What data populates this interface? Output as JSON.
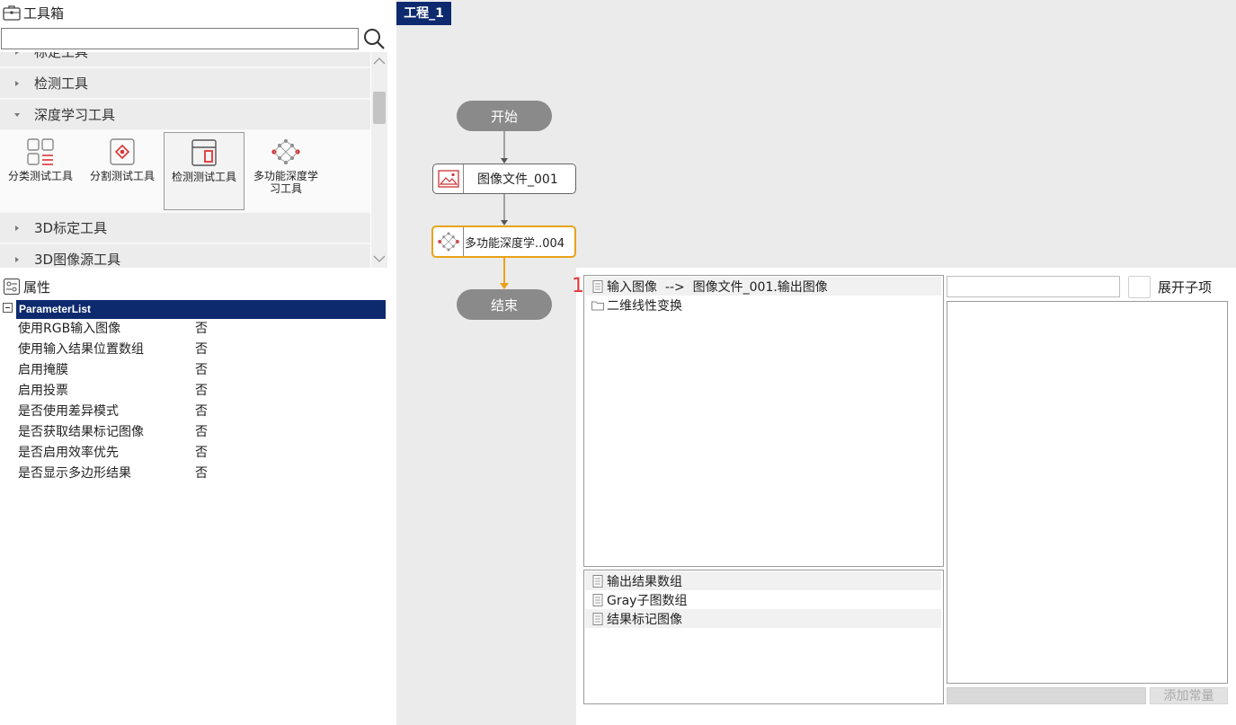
{
  "toolbox": {
    "title": "工具箱",
    "search_value": "",
    "categories": [
      {
        "label": "标定工具",
        "expanded": false
      },
      {
        "label": "检测工具",
        "expanded": false
      },
      {
        "label": "深度学习工具",
        "expanded": true
      },
      {
        "label": "3D标定工具",
        "expanded": false
      },
      {
        "label": "3D图像源工具",
        "expanded": false
      }
    ],
    "tools": [
      {
        "label": "分类测试工具",
        "icon": "classify-icon"
      },
      {
        "label": "分割测试工具",
        "icon": "segment-icon"
      },
      {
        "label": "检测测试工具",
        "icon": "detect-icon",
        "selected": true
      },
      {
        "label": "多功能深度学习工具",
        "icon": "multi-dl-icon"
      }
    ]
  },
  "properties": {
    "title": "属性",
    "list_name": "ParameterList",
    "rows": [
      {
        "key": "使用RGB输入图像",
        "value": "否"
      },
      {
        "key": "使用输入结果位置数组",
        "value": "否"
      },
      {
        "key": "启用掩膜",
        "value": "否"
      },
      {
        "key": "启用投票",
        "value": "否"
      },
      {
        "key": "是否使用差异模式",
        "value": "否"
      },
      {
        "key": "是否获取结果标记图像",
        "value": "否"
      },
      {
        "key": "是否启用效率优先",
        "value": "否"
      },
      {
        "key": "是否显示多边形结果",
        "value": "否"
      }
    ]
  },
  "canvas": {
    "tab": "工程_1",
    "nodes": {
      "start": "开始",
      "image": "图像文件_001",
      "dl": "多功能深度学..004",
      "end": "结束"
    },
    "colors": {
      "active": "#e8a317",
      "node": "#8a8a8a",
      "tab": "#0e2a6e"
    }
  },
  "panel": {
    "badge": "1",
    "inputs": [
      {
        "label": "输入图像  -->  图像文件_001.输出图像",
        "icon": "doc-icon"
      },
      {
        "label": "二维线性变换",
        "icon": "folder-icon"
      }
    ],
    "outputs": [
      {
        "label": "输出结果数组",
        "icon": "doc-icon"
      },
      {
        "label": "Gray子图数组",
        "icon": "doc-icon"
      },
      {
        "label": "结果标记图像",
        "icon": "doc-icon"
      }
    ],
    "expand_label": "展开子项",
    "add_const_label": "添加常量"
  }
}
